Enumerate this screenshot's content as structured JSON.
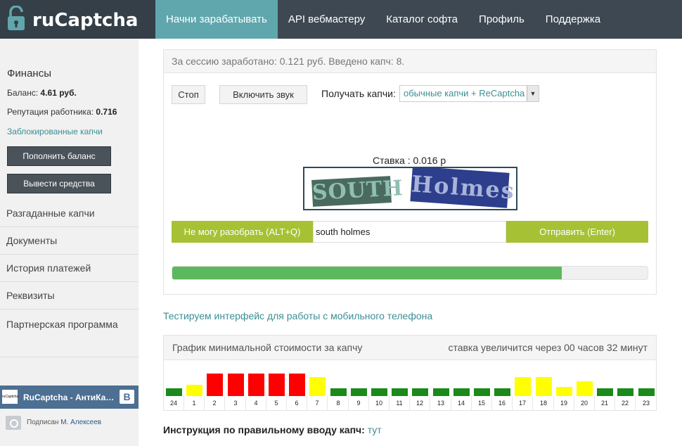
{
  "brand": {
    "name": "ruCaptcha",
    "icon": "padlock-icon"
  },
  "nav": {
    "items": [
      {
        "label": "Начни зарабатывать",
        "active": true
      },
      {
        "label": "API вебмастеру",
        "active": false
      },
      {
        "label": "Каталог софта",
        "active": false
      },
      {
        "label": "Профиль",
        "active": false
      },
      {
        "label": "Поддержка",
        "active": false
      }
    ]
  },
  "sidebar": {
    "finance_title": "Финансы",
    "balance_label": "Баланс:",
    "balance_value": "4.61 руб.",
    "reputation_label": "Репутация работника:",
    "reputation_value": "0.716",
    "blocked_link": "Заблокированные капчи",
    "topup_button": "Пополнить баланс",
    "withdraw_button": "Вывести средства",
    "menu": [
      "Разгаданные капчи",
      "Документы",
      "История платежей",
      "Реквизиты",
      "Партнерская программа"
    ],
    "vk_widget": {
      "logo_text": "ruCaptcha",
      "title": "RuCaptcha - АнтиКа…",
      "badge": "B",
      "subscribed_prefix": "Подписан",
      "subscribed_name": "М. Алексеев"
    }
  },
  "work_panel": {
    "session_text": "За сессию заработано: 0.121 руб. Введено капч: 8.",
    "stop_button": "Стоп",
    "sound_button": "Включить звук",
    "receive_label": "Получать капчи:",
    "receive_select_value": "обычные капчи + ReCaptcha",
    "rate_text": "Ставка : 0.016 р",
    "captcha_words": [
      "SOUTH",
      "Holmes"
    ],
    "cannot_solve_button": "Не могу разобрать  (ALT+Q)",
    "answer_value": "south holmes",
    "submit_button": "Отправить (Enter)",
    "timer_progress": 0.82,
    "colors": {
      "accent_green": "#a7c134",
      "progress": "#5cb85c",
      "teal": "#3a8f93"
    }
  },
  "mobile_link": "Тестируем интерфейс для работы с мобильного телефона",
  "chart_data": {
    "type": "bar",
    "title": "График минимальной стоимости за капчу",
    "subtitle": "ставка увеличится через 00 часов 32 минут",
    "categories": [
      "24",
      "1",
      "2",
      "3",
      "4",
      "5",
      "6",
      "7",
      "8",
      "9",
      "10",
      "11",
      "12",
      "13",
      "14",
      "15",
      "16",
      "17",
      "18",
      "19",
      "20",
      "21",
      "22",
      "23"
    ],
    "values": [
      1,
      1.5,
      3,
      3,
      3,
      3,
      3,
      2.5,
      1,
      1,
      1,
      1,
      1,
      1,
      1,
      1,
      1,
      2.5,
      2.5,
      1.2,
      2,
      1,
      1,
      1
    ],
    "bar_colors": [
      "#1a8a1a",
      "#ffff00",
      "#ff0000",
      "#ff0000",
      "#ff0000",
      "#ff0000",
      "#ff0000",
      "#ffff00",
      "#1a8a1a",
      "#1a8a1a",
      "#1a8a1a",
      "#1a8a1a",
      "#1a8a1a",
      "#1a8a1a",
      "#1a8a1a",
      "#1a8a1a",
      "#1a8a1a",
      "#ffff00",
      "#ffff00",
      "#ffff00",
      "#ffff00",
      "#1a8a1a",
      "#1a8a1a",
      "#1a8a1a"
    ],
    "ylim": [
      0,
      3.2
    ],
    "grid": false
  },
  "instruction": {
    "text": "Инструкция по правильному вводу капч:",
    "link": "тут"
  }
}
